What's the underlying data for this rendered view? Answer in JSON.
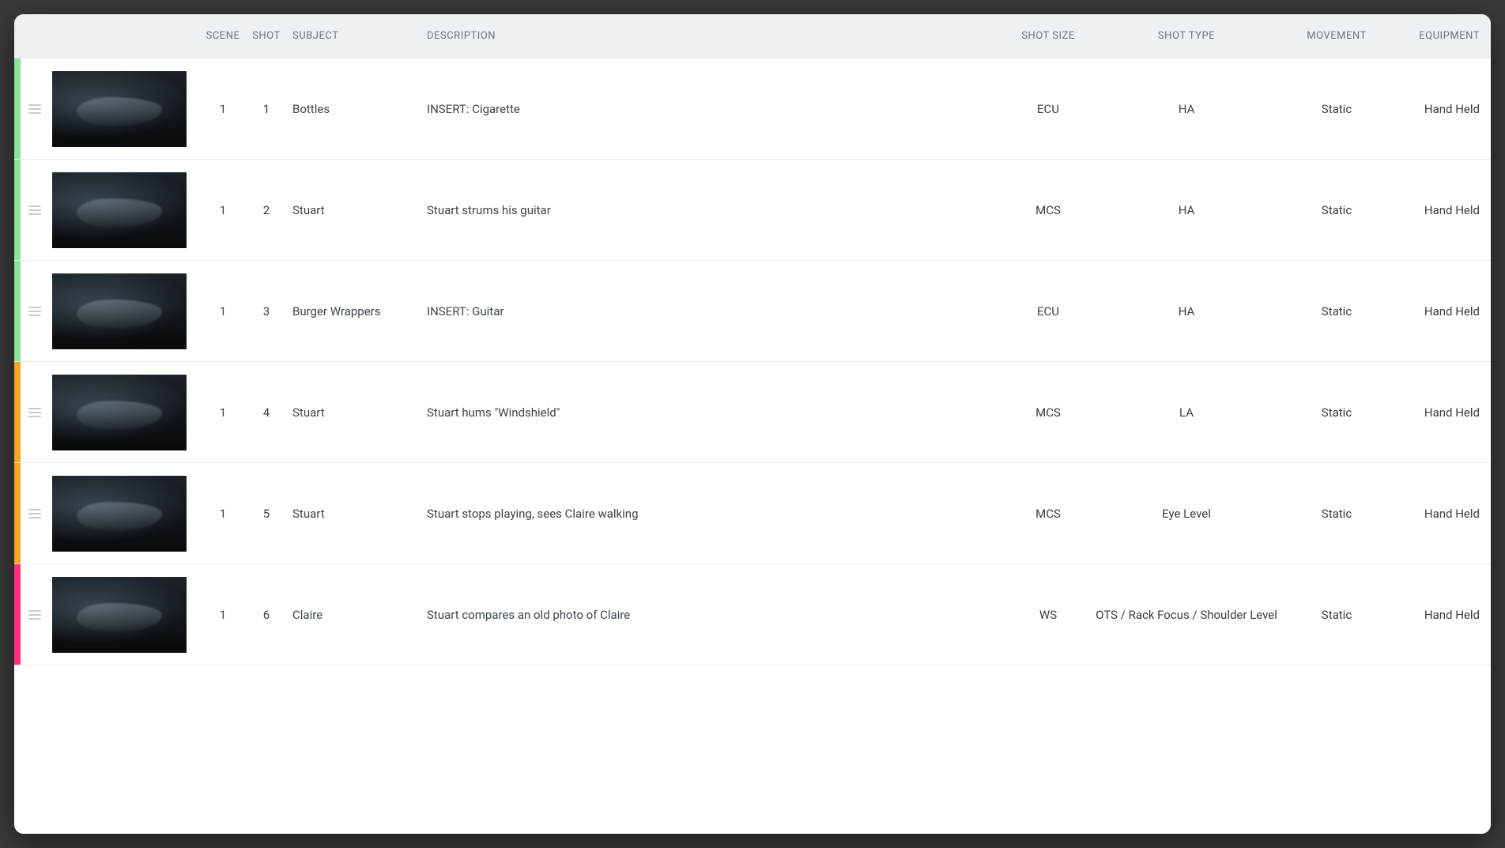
{
  "columns": {
    "scene": "SCENE",
    "shot": "SHOT",
    "subject": "SUBJECT",
    "description": "DESCRIPTION",
    "shot_size": "SHOT SIZE",
    "shot_type": "SHOT TYPE",
    "movement": "MOVEMENT",
    "equipment": "EQUIPMENT"
  },
  "colors": {
    "green": "#8ce29a",
    "orange": "#f5a623",
    "pink": "#ff2e7e"
  },
  "shots": [
    {
      "color": "green",
      "scene": "1",
      "shot": "1",
      "subject": "Bottles",
      "description": "INSERT: Cigarette",
      "shot_size": "ECU",
      "shot_type": "HA",
      "movement": "Static",
      "equipment": "Hand Held"
    },
    {
      "color": "green",
      "scene": "1",
      "shot": "2",
      "subject": "Stuart",
      "description": "Stuart strums his guitar",
      "shot_size": "MCS",
      "shot_type": "HA",
      "movement": "Static",
      "equipment": "Hand Held"
    },
    {
      "color": "green",
      "scene": "1",
      "shot": "3",
      "subject": "Burger Wrappers",
      "description": "INSERT: Guitar",
      "shot_size": "ECU",
      "shot_type": "HA",
      "movement": "Static",
      "equipment": "Hand Held"
    },
    {
      "color": "orange",
      "scene": "1",
      "shot": "4",
      "subject": "Stuart",
      "description": "Stuart hums \"Windshield\"",
      "shot_size": "MCS",
      "shot_type": "LA",
      "movement": "Static",
      "equipment": "Hand Held"
    },
    {
      "color": "orange",
      "scene": "1",
      "shot": "5",
      "subject": "Stuart",
      "description": "Stuart stops playing, sees Claire walking",
      "shot_size": "MCS",
      "shot_type": "Eye Level",
      "movement": "Static",
      "equipment": "Hand Held"
    },
    {
      "color": "pink",
      "scene": "1",
      "shot": "6",
      "subject": "Claire",
      "description": "Stuart compares an old photo of Claire",
      "shot_size": "WS",
      "shot_type": "OTS / Rack Focus / Shoulder Level",
      "movement": "Static",
      "equipment": "Hand Held"
    }
  ]
}
